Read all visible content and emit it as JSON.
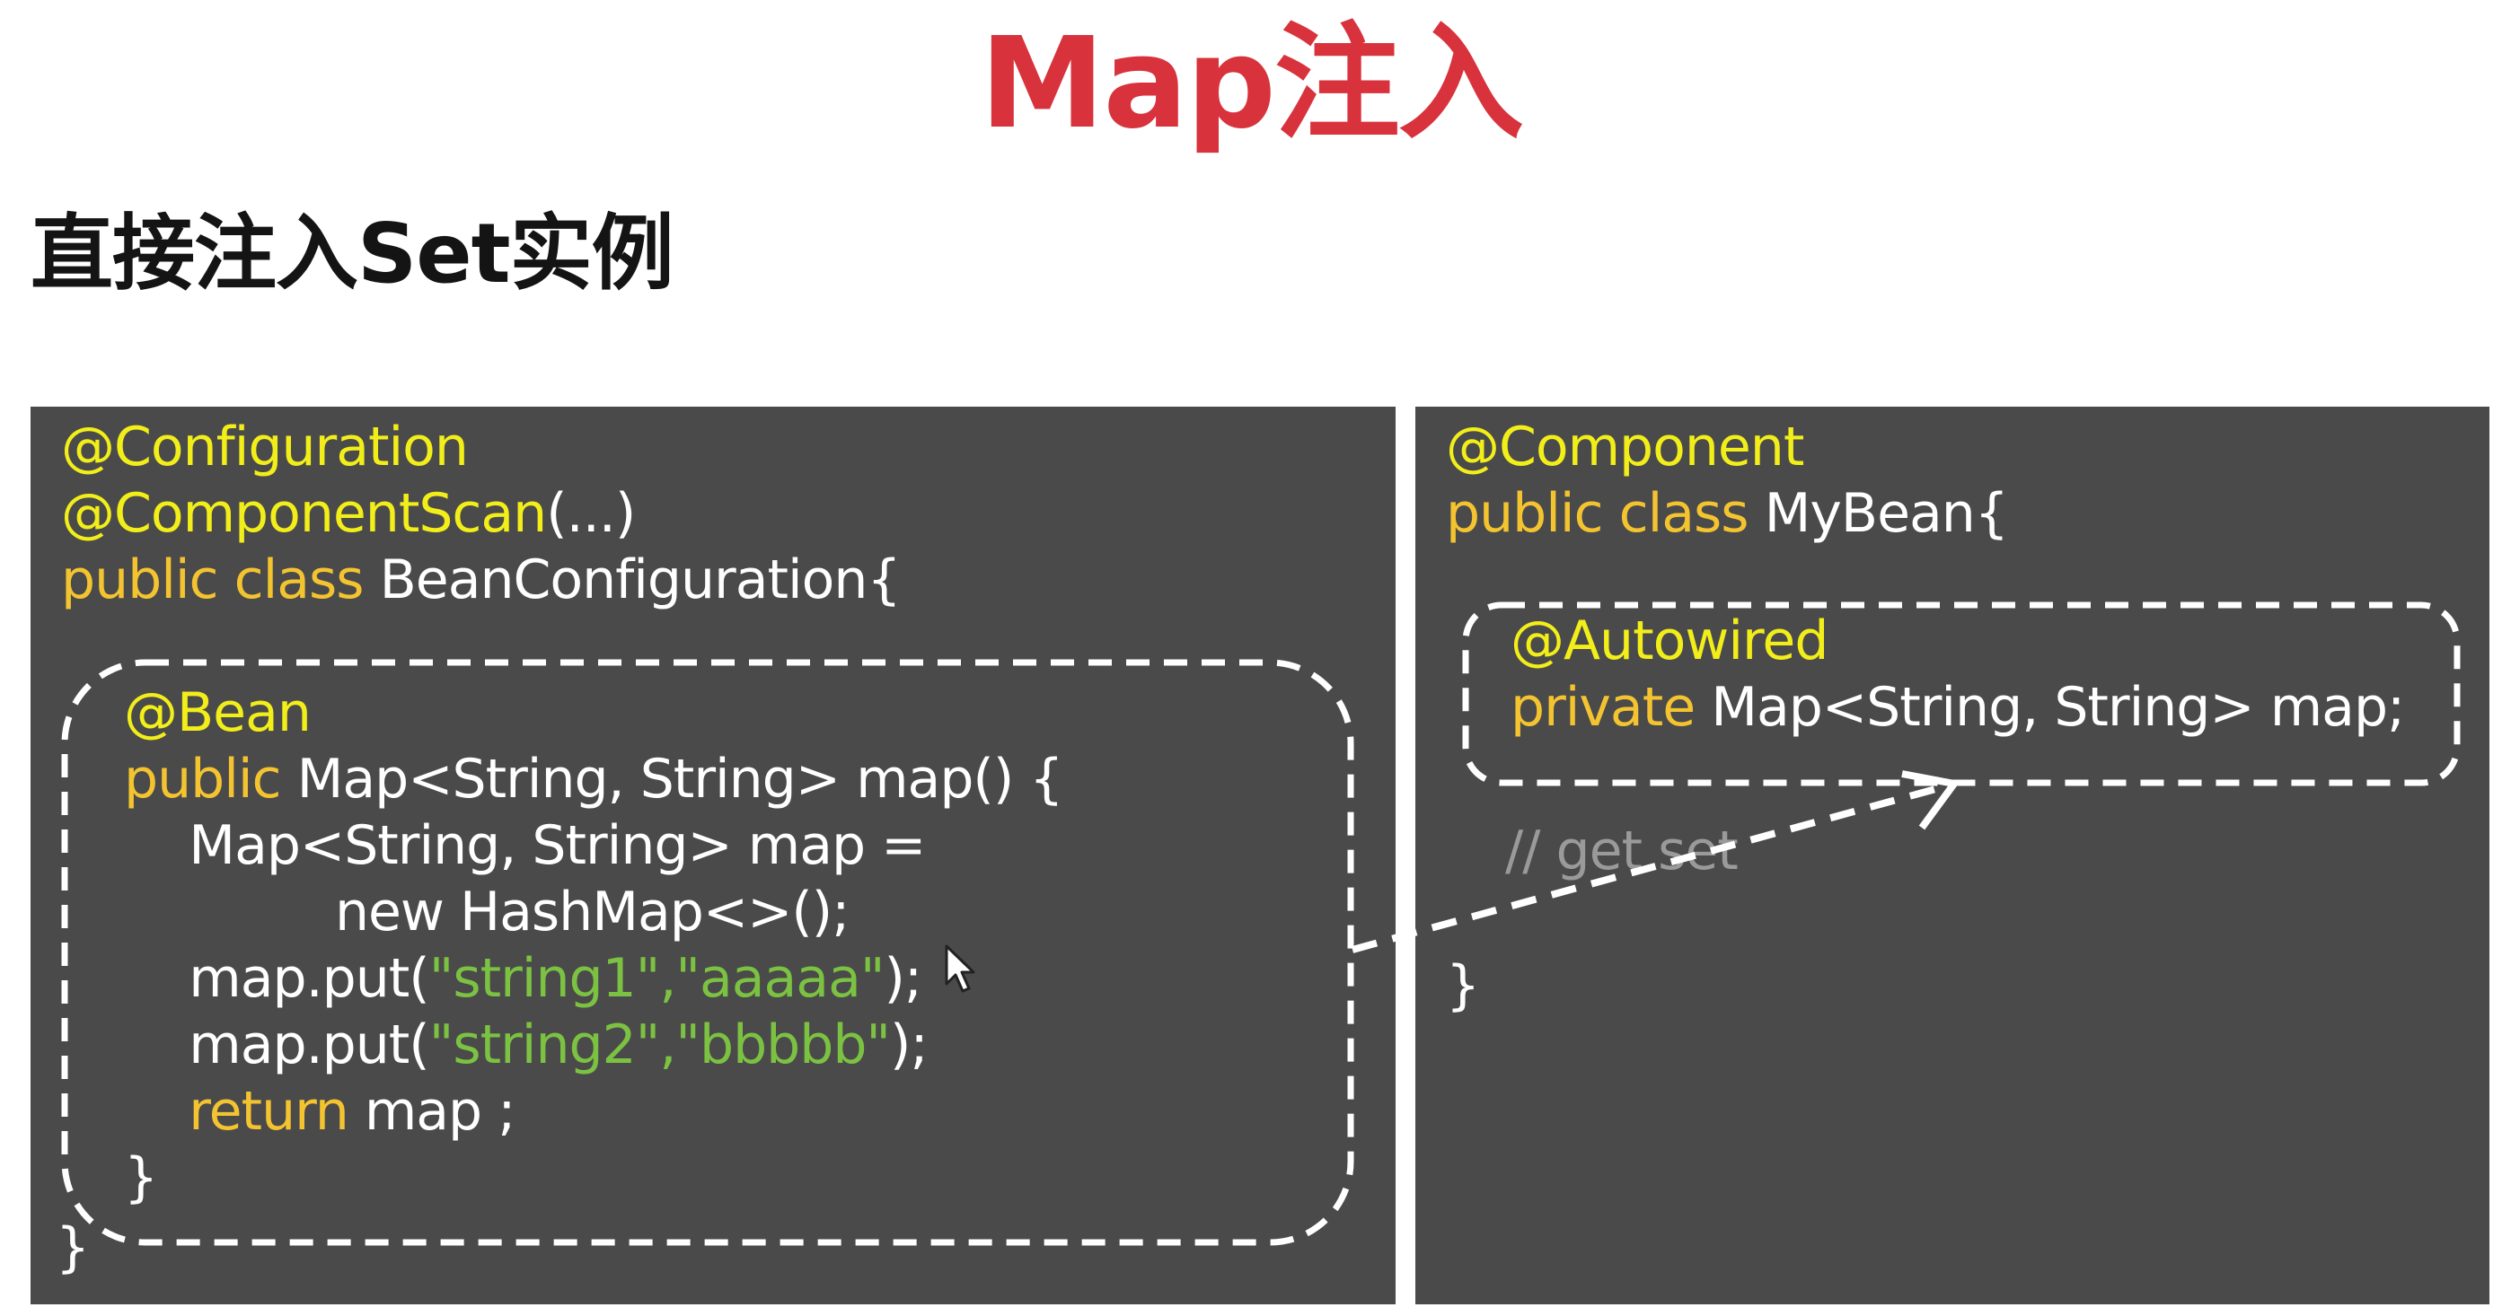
{
  "slide": {
    "title": "Map注入",
    "subtitle": "直接注入Set实例"
  },
  "colors": {
    "title": "#d8333d",
    "panel_bg": "#4a4a4a",
    "keyword": "#f4c430",
    "annotation": "#f2ee1a",
    "string": "#7cc242",
    "comment": "#9a9a9a",
    "dashed_border": "#ffffff"
  },
  "left_code": {
    "anno_config": "@Configuration",
    "anno_scan": "@ComponentScan",
    "anno_scan_args": "(...)",
    "kw_public_class": "public class ",
    "class_name": "BeanConfiguration{",
    "anno_bean": "@Bean",
    "kw_public": "public",
    "method_sig": " Map<String, String> map() {",
    "map_decl": "Map<String, String> map =",
    "map_new": "new HashMap<>();",
    "put1_prefix": "map.put(",
    "put1_str": "\"string1\",\"aaaaa\"",
    "put1_suffix": ");",
    "put2_prefix": "map.put(",
    "put2_str": "\"string2\",\"bbbbb\"",
    "put2_suffix": ");",
    "kw_return": "return",
    "return_rest": " map ;",
    "method_close": "}",
    "class_close": "}"
  },
  "right_code": {
    "anno_component": "@Component",
    "kw_public_class": "public class ",
    "class_name": "MyBean{",
    "anno_autowired": "@Autowired",
    "kw_private": "private",
    "field_decl": " Map<String, String> map;",
    "comment": "// get set",
    "class_close": "}"
  },
  "icons": {
    "cursor": "mouse-pointer-icon",
    "arrow": "injection-arrow"
  }
}
